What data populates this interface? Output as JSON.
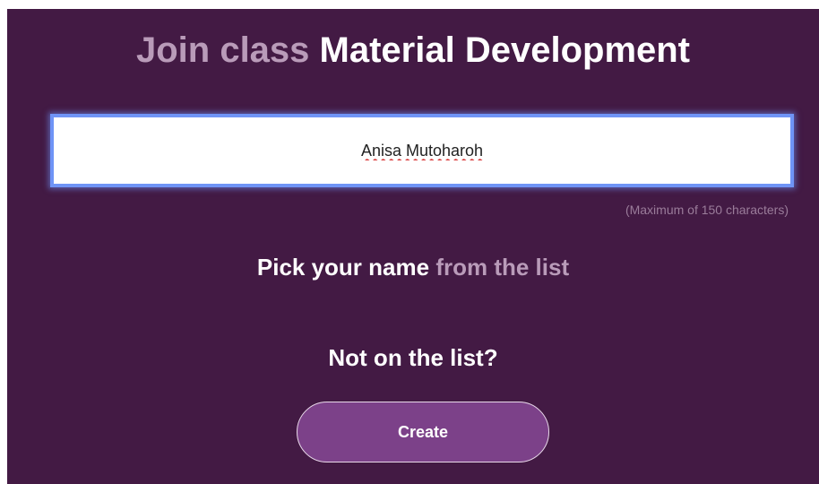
{
  "header": {
    "prefix": "Join class",
    "class_name": "Material Development"
  },
  "name_input": {
    "value": "Anisa Mutoharoh",
    "hint": "(Maximum of 150 characters)"
  },
  "pick": {
    "strong": "Pick your name",
    "muted": "from the list"
  },
  "not_on_list": "Not on the list?",
  "create_button": {
    "label": "Create"
  },
  "colors": {
    "background": "#431a44",
    "muted_text": "#b99bb9",
    "focus_ring": "#6f94f6",
    "button": "#7c4189"
  }
}
